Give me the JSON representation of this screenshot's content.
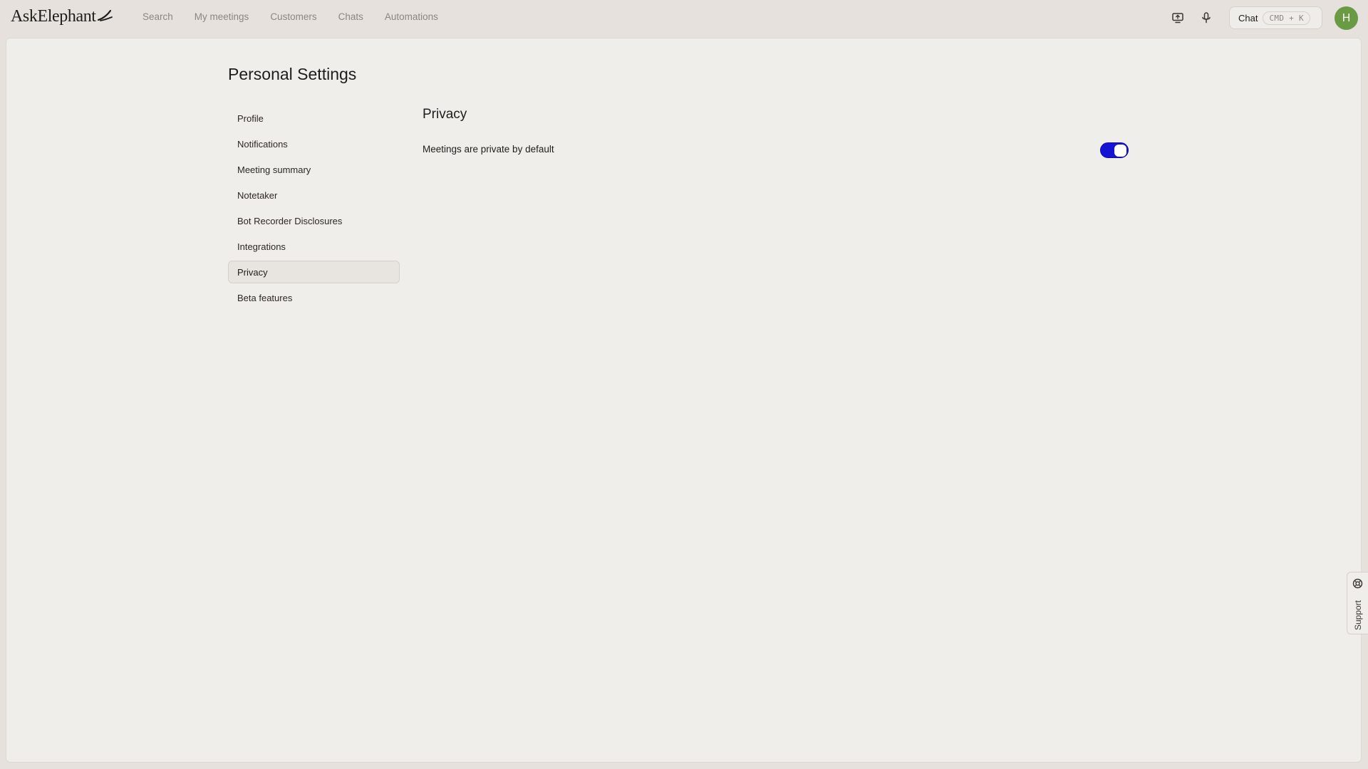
{
  "app": {
    "logo_text": "AskElephant"
  },
  "nav": {
    "items": [
      {
        "label": "Search"
      },
      {
        "label": "My meetings"
      },
      {
        "label": "Customers"
      },
      {
        "label": "Chats"
      },
      {
        "label": "Automations"
      }
    ]
  },
  "header": {
    "icons": [
      "screen-share-icon",
      "microphone-icon"
    ],
    "chat_label": "Chat",
    "chat_shortcut": "CMD + K",
    "avatar_initial": "H",
    "avatar_color": "#6b9a45"
  },
  "page": {
    "title": "Personal Settings"
  },
  "sidebar": {
    "items": [
      {
        "label": "Profile",
        "active": false
      },
      {
        "label": "Notifications",
        "active": false
      },
      {
        "label": "Meeting summary",
        "active": false
      },
      {
        "label": "Notetaker",
        "active": false
      },
      {
        "label": "Bot Recorder Disclosures",
        "active": false
      },
      {
        "label": "Integrations",
        "active": false
      },
      {
        "label": "Privacy",
        "active": true
      },
      {
        "label": "Beta features",
        "active": false
      }
    ]
  },
  "privacy": {
    "section_title": "Privacy",
    "setting_label": "Meetings are private by default",
    "setting_enabled": true,
    "toggle_color": "#1414d2"
  },
  "support": {
    "label": "Support"
  }
}
